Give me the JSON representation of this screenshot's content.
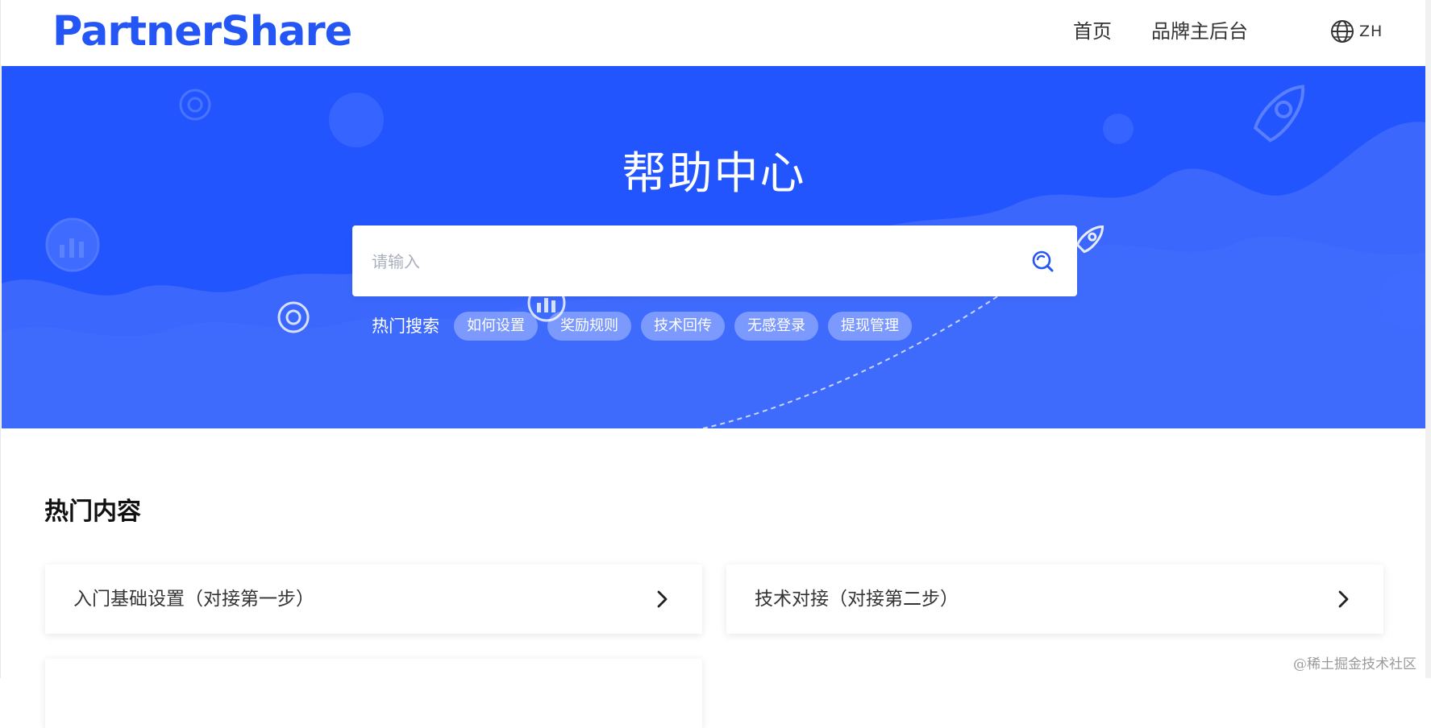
{
  "header": {
    "logo_text": "PartnerShare",
    "nav": {
      "home": "首页",
      "brand_admin": "品牌主后台"
    },
    "language": {
      "code": "ZH",
      "icon": "globe-icon"
    }
  },
  "hero": {
    "title": "帮助中心",
    "search": {
      "placeholder": "请输入",
      "value": "",
      "icon": "search-icon"
    },
    "hot_search": {
      "label": "热门搜索",
      "tags": [
        "如何设置",
        "奖励规则",
        "技术回传",
        "无感登录",
        "提现管理"
      ]
    }
  },
  "hot_content": {
    "title": "热门内容",
    "cards": [
      {
        "label": "入门基础设置（对接第一步）",
        "icon": "chevron-right-icon"
      },
      {
        "label": "技术对接（对接第二步）",
        "icon": "chevron-right-icon"
      },
      {
        "label": ""
      }
    ]
  },
  "watermark": "@稀土掘金技术社区",
  "colors": {
    "brand": "#2456f5",
    "hero_bg": "#2355fe",
    "tag_bg": "rgba(255,255,255,0.32)"
  }
}
